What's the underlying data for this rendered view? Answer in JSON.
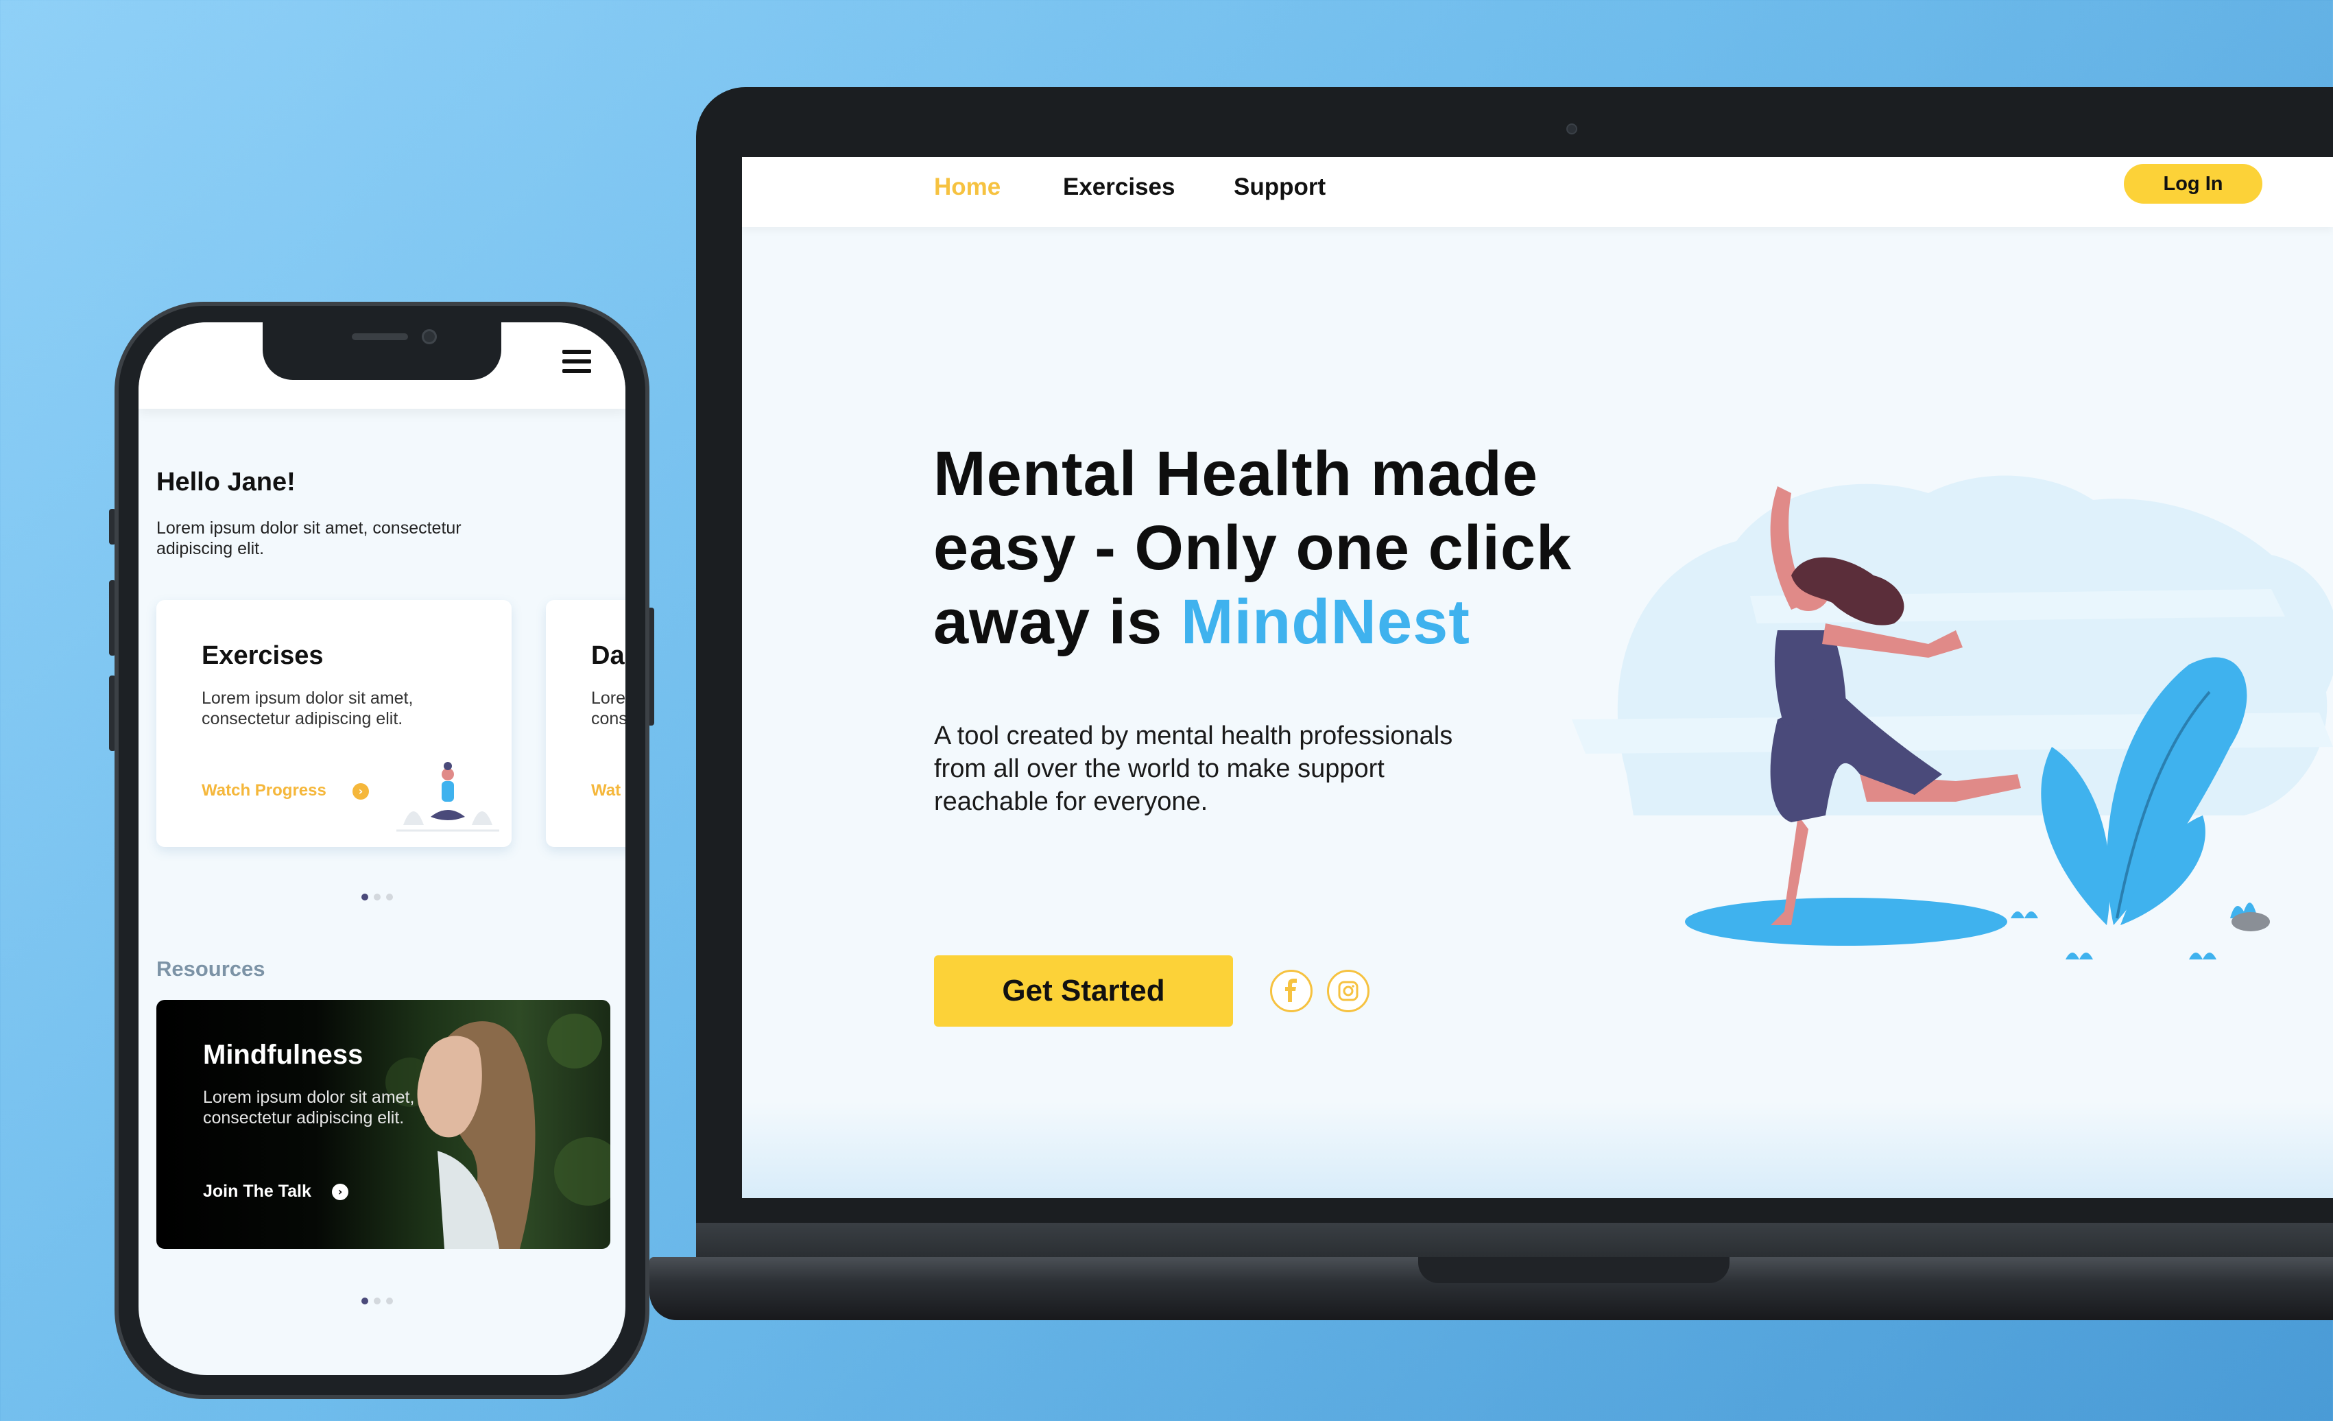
{
  "laptop": {
    "nav": {
      "items": [
        {
          "label": "Home",
          "active": true
        },
        {
          "label": "Exercises",
          "active": false
        },
        {
          "label": "Support",
          "active": false
        }
      ],
      "login_label": "Log In"
    },
    "hero": {
      "headline_line1": "Mental Health made",
      "headline_line2": "easy - Only one click",
      "headline_line3_prefix": "away is ",
      "headline_brand": "MindNest",
      "subtitle": "A tool created by mental health professionals from all over the world to make support reachable for everyone.",
      "cta_label": "Get Started",
      "social_icons": [
        "facebook-icon",
        "instagram-icon"
      ]
    }
  },
  "phone": {
    "greeting": "Hello Jane!",
    "greeting_sub": "Lorem ipsum dolor sit amet, consectetur adipiscing elit.",
    "cards": [
      {
        "title": "Exercises",
        "text": "Lorem ipsum dolor sit amet, consectetur adipiscing elit.",
        "link": "Watch Progress"
      },
      {
        "title": "Da",
        "text": "Lore cons",
        "link": "Wat"
      }
    ],
    "resources_heading": "Resources",
    "resource_card": {
      "title": "Mindfulness",
      "text": "Lorem ipsum dolor sit amet, consectetur adipiscing elit.",
      "link": "Join The Talk"
    }
  },
  "colors": {
    "accent_yellow": "#fcd238",
    "brand_blue": "#3fb2ee",
    "link_orange": "#f5b73b"
  }
}
